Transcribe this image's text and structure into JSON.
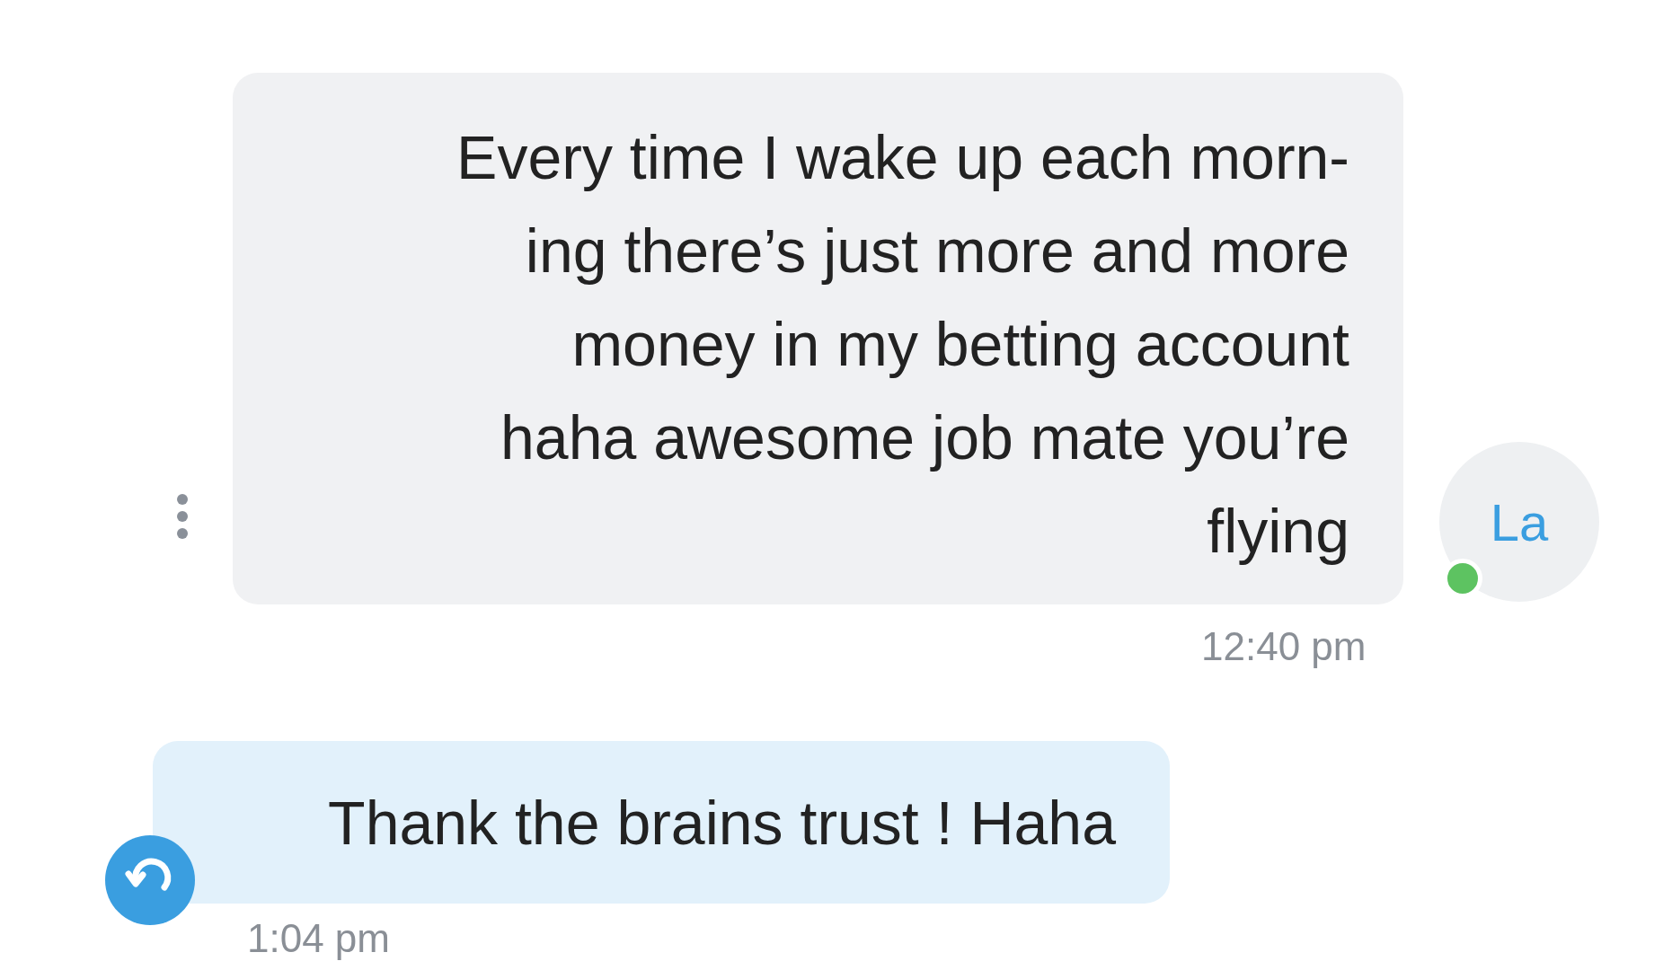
{
  "messages": [
    {
      "kind": "received",
      "avatar": {
        "initials": "La",
        "online": true
      },
      "lines": [
        "Every time I wake up each morn-",
        "ing there’s just more and more",
        "money in my betting account",
        "haha awesome job mate you’re",
        "flying"
      ],
      "time": "12:40 pm"
    },
    {
      "kind": "sent",
      "lines": [
        "Thank the brains trust ! Haha"
      ],
      "time": "1:04 pm"
    }
  ]
}
